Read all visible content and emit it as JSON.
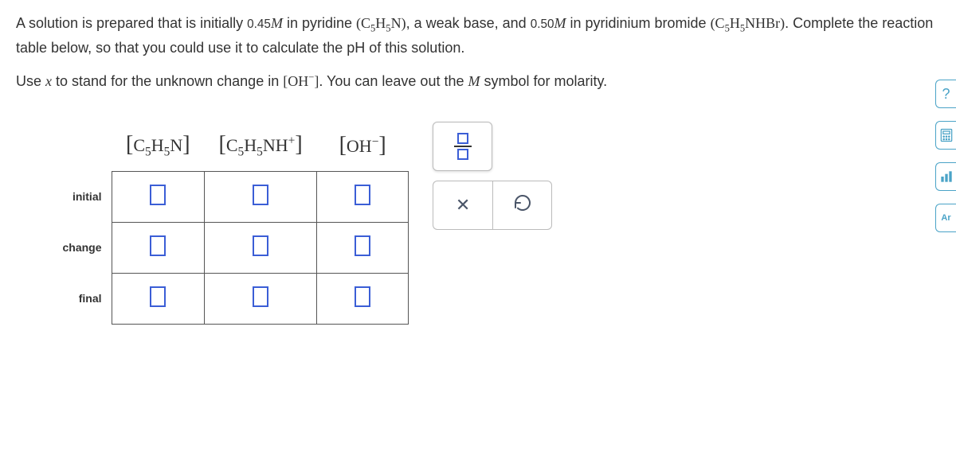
{
  "question": {
    "p1_a": "A solution is prepared that is initially ",
    "p1_conc1": "0.45",
    "p1_unit1": "M",
    "p1_b": " in pyridine ",
    "p1_formula1": "C₅H₅N",
    "p1_c": ", a weak base, and ",
    "p1_conc2": "0.50",
    "p1_unit2": "M",
    "p1_d": " in pyridinium bromide ",
    "p1_formula2": "C₅H₅NHBr",
    "p1_e": ". Complete the reaction table below, so that you could use it to calculate the pH of this solution.",
    "p2_a": "Use ",
    "p2_var": "x",
    "p2_b": " to stand for the unknown change in ",
    "p2_species": "OH⁻",
    "p2_c": ". You can leave out the ",
    "p2_unit": "M",
    "p2_d": " symbol for molarity."
  },
  "table": {
    "headers": {
      "col1": "C₅H₅N",
      "col2": "C₅H₅NH⁺",
      "col3": "OH⁻"
    },
    "rows": {
      "initial": "initial",
      "change": "change",
      "final": "final"
    }
  },
  "sidebar": {
    "help": "?",
    "ar": "Ar"
  }
}
